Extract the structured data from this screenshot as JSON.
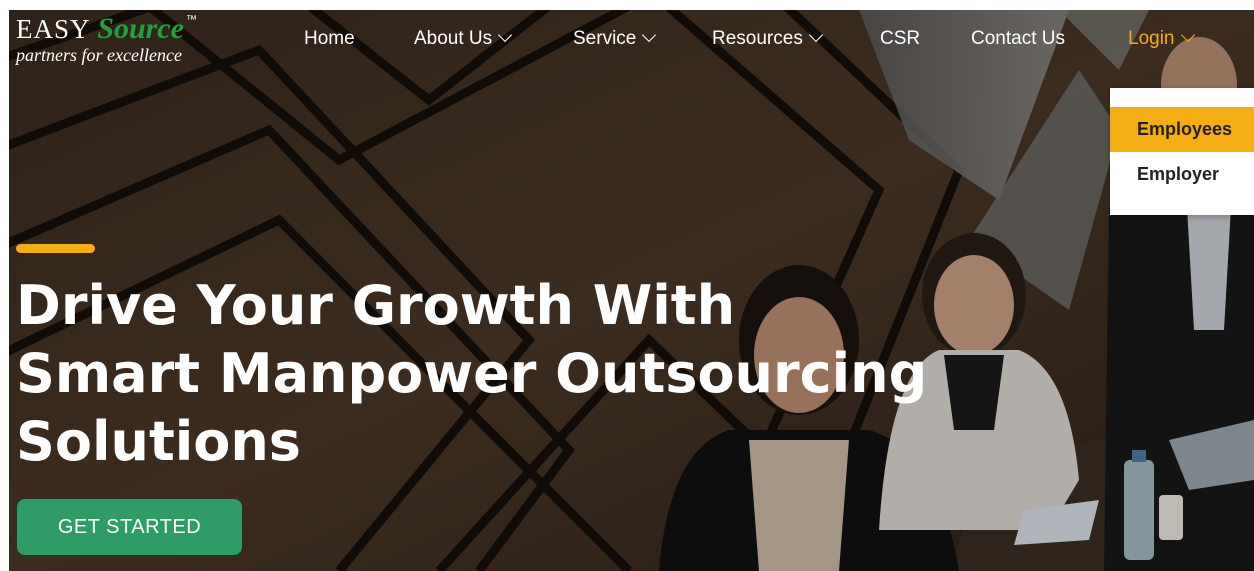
{
  "logo": {
    "easy": "EASY",
    "source": "Source",
    "tm": "™",
    "tagline": "partners for excellence"
  },
  "nav": {
    "home": "Home",
    "about": "About Us",
    "service": "Service",
    "resources": "Resources",
    "csr": "CSR",
    "contact": "Contact Us",
    "login": "Login"
  },
  "login_menu": {
    "items": [
      "Employees",
      "Employer"
    ],
    "selected": "Employees"
  },
  "hero": {
    "line1": "Drive Your Growth With",
    "line2": "Smart Manpower Outsourcing",
    "line3": "Solutions",
    "cta": "GET STARTED"
  },
  "colors": {
    "accent": "#f5ad16",
    "cta": "#2f9b67",
    "logo_green": "#1ea33a"
  }
}
